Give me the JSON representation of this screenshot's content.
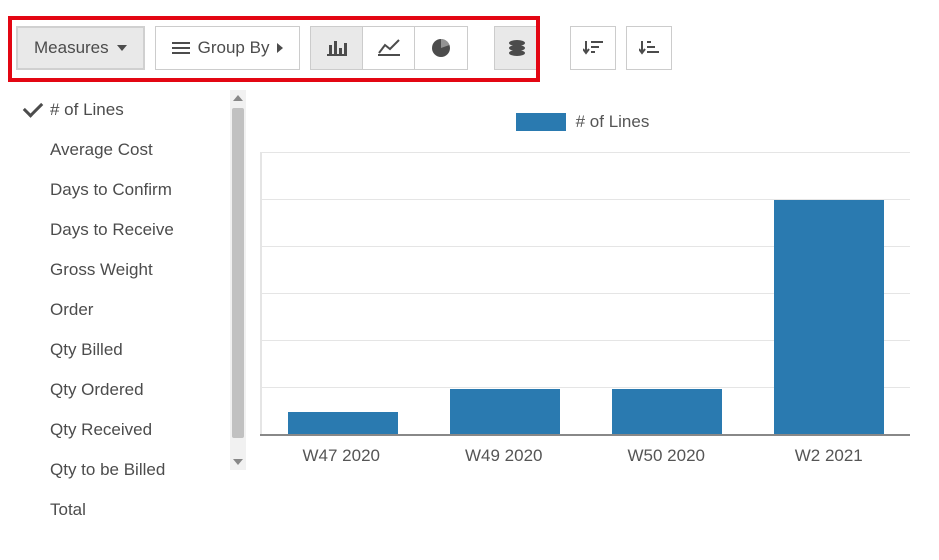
{
  "toolbar": {
    "measures_label": "Measures",
    "groupby_label": "Group By"
  },
  "measures_menu": {
    "selected_index": 0,
    "items": [
      "# of Lines",
      "Average Cost",
      "Days to Confirm",
      "Days to Receive",
      "Gross Weight",
      "Order",
      "Qty Billed",
      "Qty Ordered",
      "Qty Received",
      "Qty to be Billed",
      "Total"
    ]
  },
  "legend": {
    "label": "# of Lines",
    "color": "#2a7ab0"
  },
  "chart_data": {
    "type": "bar",
    "title": "",
    "xlabel": "",
    "ylabel": "",
    "legend_position": "top",
    "grid": true,
    "categories": [
      "W47 2020",
      "W49 2020",
      "W50 2020",
      "W2 2021"
    ],
    "series": [
      {
        "name": "# of Lines",
        "values": [
          1,
          2,
          2,
          10
        ]
      }
    ],
    "ylim": [
      0,
      12
    ]
  }
}
